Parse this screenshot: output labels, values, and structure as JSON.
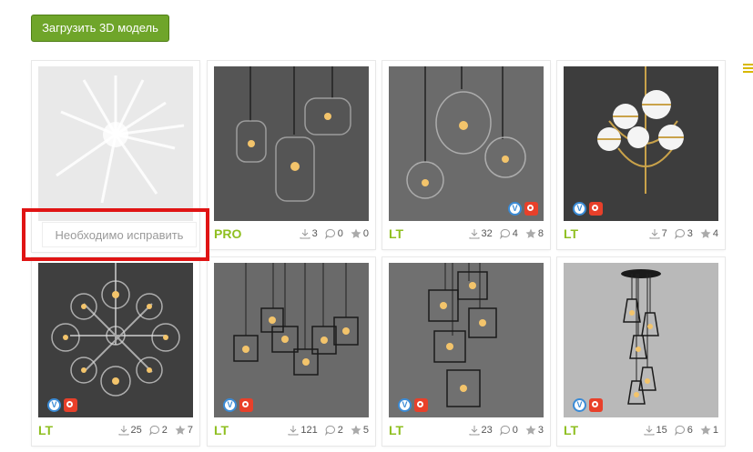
{
  "toolbar": {
    "upload_label": "Загрузить 3D модель"
  },
  "cards": [
    {
      "tier": "",
      "downloads": "",
      "comments": "",
      "stars": "",
      "dim": true,
      "fix_label": "Необходимо исправить"
    },
    {
      "tier": "PRO",
      "downloads": "3",
      "comments": "0",
      "stars": "0"
    },
    {
      "tier": "LT",
      "downloads": "32",
      "comments": "4",
      "stars": "8"
    },
    {
      "tier": "LT",
      "downloads": "7",
      "comments": "3",
      "stars": "4"
    },
    {
      "tier": "LT",
      "downloads": "25",
      "comments": "2",
      "stars": "7"
    },
    {
      "tier": "LT",
      "downloads": "121",
      "comments": "2",
      "stars": "5"
    },
    {
      "tier": "LT",
      "downloads": "23",
      "comments": "0",
      "stars": "3"
    },
    {
      "tier": "LT",
      "downloads": "15",
      "comments": "6",
      "stars": "1"
    }
  ],
  "colors": {
    "accent_green": "#6fa52a",
    "tier_green": "#8fbf21",
    "alert_red": "#e01414"
  }
}
